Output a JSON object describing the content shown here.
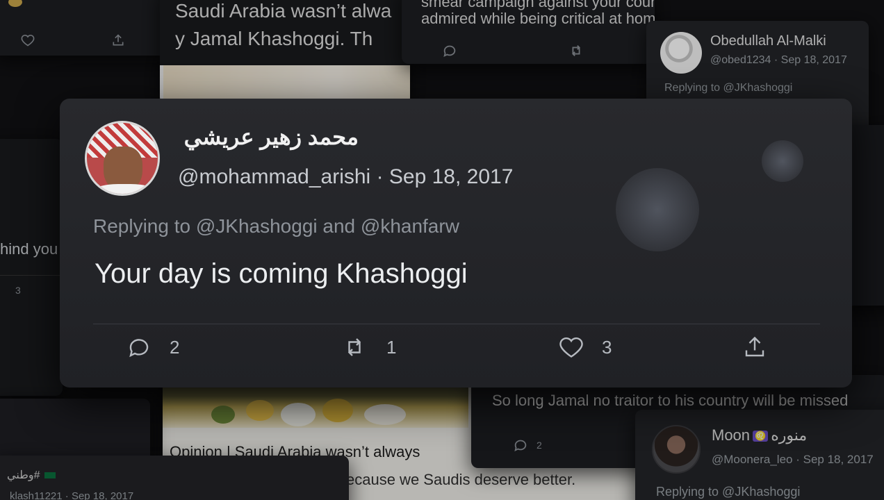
{
  "main_tweet": {
    "display_name": "محمد زهير عريشي",
    "handle": "@mohammad_arishi",
    "date": "· Sep 18, 2017",
    "replying_to": "Replying to @JKhashoggi and @khanfarw",
    "text": "Your day is coming Khashoggi",
    "reply_count": "2",
    "retweet_count": "1",
    "like_count": "3"
  },
  "top_mid_tweet": {
    "line1": "smear campaign against your country. You were more",
    "line2": "admired while being critical at home"
  },
  "top_article": {
    "line1": "Saudi Arabia wasn’t alwa",
    "line2": "y Jamal Khashoggi. Th"
  },
  "obed_tweet": {
    "display_name": "Obedullah Al-Malki",
    "handle": "@obed1234 · Sep 18, 2017",
    "replying_to": "Replying to @JKhashoggi"
  },
  "left_tweet": {
    "text": "hind you",
    "count": "3"
  },
  "bottom_article": {
    "headline": "Opinion | Saudi Arabia wasn’t always",
    "subline": "ecause we Saudis deserve better."
  },
  "watani_tweet": {
    "display_name": "وطني#",
    "handle": "klash11221 · Sep 18, 2017"
  },
  "solong_tweet": {
    "text": "So long Jamal no traitor to his country will be missed",
    "reply_count": "2"
  },
  "moon_tweet": {
    "name_latin": "Moon",
    "zodiac": "♌",
    "name_arabic": "منوره",
    "handle": "@Moonera_leo · Sep 18, 2017",
    "replying_to": "Replying to @JKhashoggi"
  },
  "colors": {
    "card_bg": "#1c1d21",
    "main_card_bg": "#28292d",
    "muted_text": "#8e939a",
    "zodiac_badge": "#6b4fc8"
  }
}
